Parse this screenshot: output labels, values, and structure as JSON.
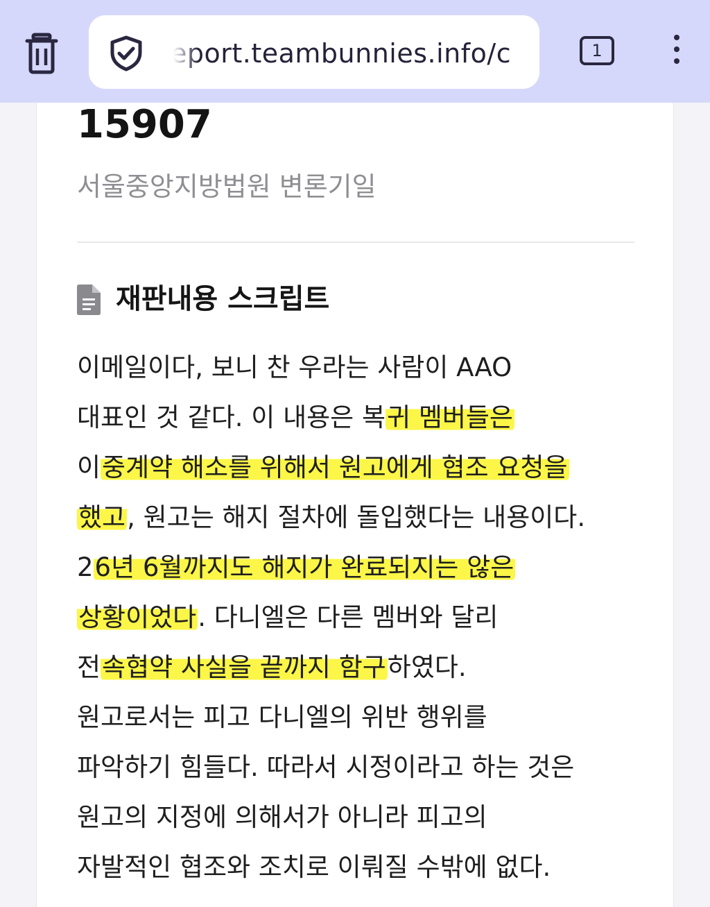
{
  "browser": {
    "url": "eport.teambunnies.info/c",
    "tab_count": "1"
  },
  "page": {
    "case_number": "15907",
    "court_name": "서울중앙지방법원 변론기일",
    "section_title": "재판내용 스크립트",
    "lines": [
      {
        "before": "이메일이다, 보니 찬 우라는 사람이 AAO",
        "highlight": "",
        "after": ""
      },
      {
        "before": "대표인 것 같다. 이 내용은 복",
        "highlight": "귀 멤버들은",
        "after": ""
      },
      {
        "before": "이",
        "highlight": "중계약 해소를 위해서 원고에게 협조 요청을",
        "after": ""
      },
      {
        "before": "",
        "highlight": "했고",
        "after": ", 원고는 해지 절차에 돌입했다는 내용이다."
      },
      {
        "before": "2",
        "highlight": "6년 6월까지도 해지가 완료되지는 않은",
        "after": ""
      },
      {
        "before": "",
        "highlight": "상황이었다",
        "after": ". 다니엘은 다른 멤버와 달리"
      },
      {
        "before": "전",
        "highlight": "속협약 사실을 끝까지 함구",
        "after": "하였다."
      },
      {
        "before": "원고로서는 피고 다니엘의 위반 행위를",
        "highlight": "",
        "after": ""
      },
      {
        "before": "파악하기 힘들다. 따라서 시정이라고 하는 것은",
        "highlight": "",
        "after": ""
      },
      {
        "before": "원고의 지정에 의해서가 아니라 피고의",
        "highlight": "",
        "after": ""
      },
      {
        "before": "자발적인 협조와 조치로 이뤄질 수밖에 없다.",
        "highlight": "",
        "after": ""
      }
    ]
  },
  "icons": {
    "trash": "trash-icon",
    "shield": "shield-check-icon",
    "tabs": "tab-switcher-icon",
    "menu": "more-vertical-icon",
    "document": "document-icon"
  },
  "colors": {
    "toolbar_bg": "#d6d8fb",
    "highlighter": "#faf528",
    "icon": "#2a2740"
  }
}
